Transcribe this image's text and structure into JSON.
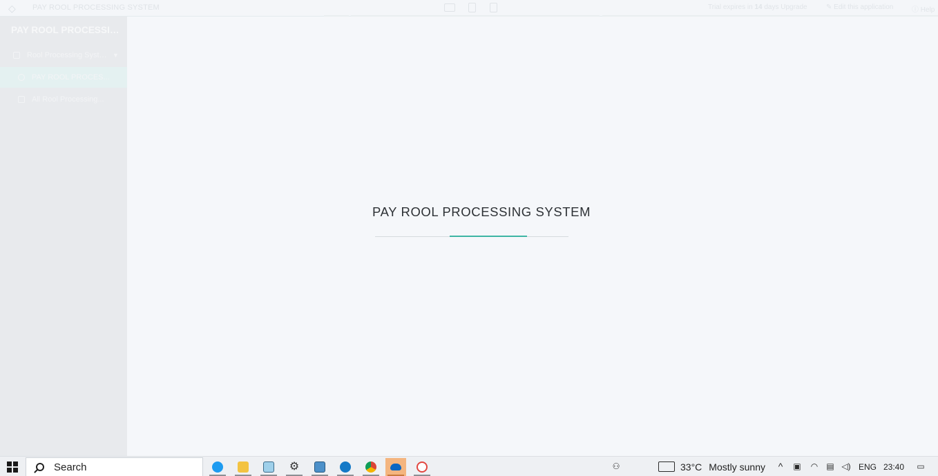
{
  "topbar": {
    "app_title": "PAY ROOL PROCESSING SYSTEM",
    "trial_prefix": "Trial expires in",
    "trial_days": "14",
    "trial_suffix": "days Upgrade",
    "edit_label": "Edit this application",
    "help_label": "Help"
  },
  "sidebar": {
    "brand": "PAY ROOL PROCESSIN...",
    "items": [
      {
        "label": "Rool Processing Syste...",
        "icon": "folder-icon",
        "expanded": true
      },
      {
        "label": "PAY ROOL PROCES...",
        "icon": "dashboard-icon",
        "active": true
      },
      {
        "label": "All Rool Processing...",
        "icon": "table-icon"
      }
    ]
  },
  "main": {
    "loading_title": "PAY ROOL PROCESSING SYSTEM",
    "progress_fraction": 0.4,
    "accent_color": "#3db5a4"
  },
  "taskbar": {
    "search_label": "Search",
    "apps": [
      "twitter-icon",
      "file-explorer-icon",
      "notepad-icon",
      "settings-icon",
      "control-panel-icon",
      "edge-icon",
      "chrome-icon",
      "onedrive-icon",
      "paint-icon"
    ],
    "weather_temp": "33°C",
    "weather_text": "Mostly sunny",
    "language": "ENG",
    "time": "23:40"
  }
}
